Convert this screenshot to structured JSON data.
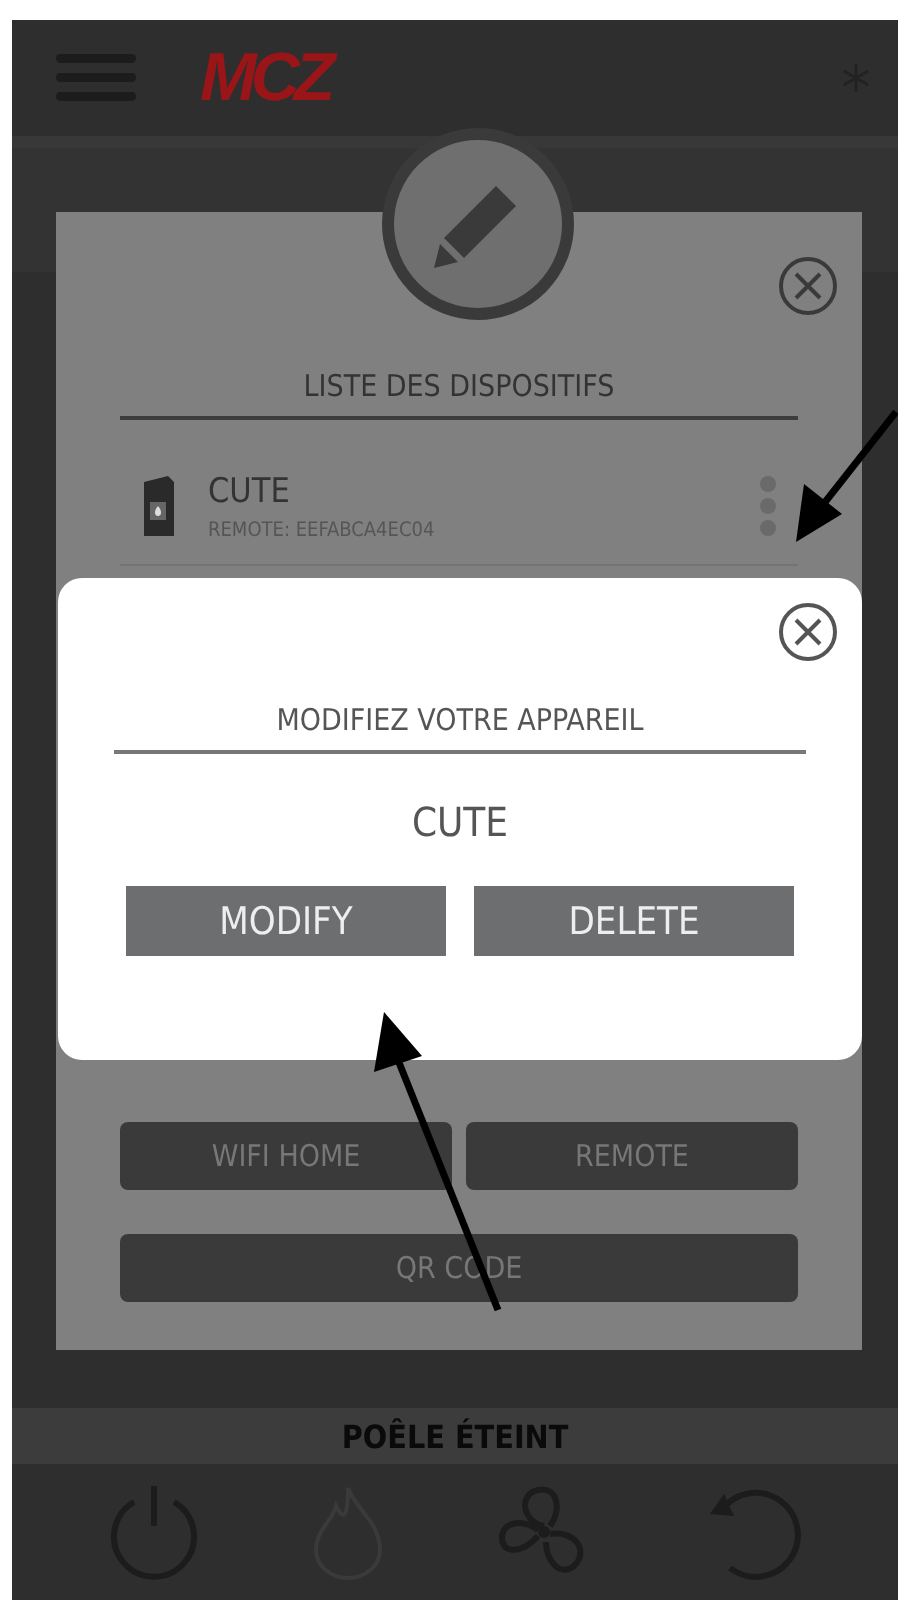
{
  "header": {
    "logo": "MCZ"
  },
  "device_panel": {
    "title": "LISTE DES DISPOSITIFS",
    "devices": [
      {
        "name": "CUTE",
        "detail": "REMOTE: EEFABCA4EC04"
      }
    ],
    "buttons": [
      "WIFI HOME",
      "REMOTE"
    ],
    "wide_button": "QR CODE"
  },
  "modal": {
    "title": "MODIFIEZ VOTRE APPAREIL",
    "device_name": "CUTE",
    "buttons": [
      "MODIFY",
      "DELETE"
    ]
  },
  "status": "POÊLE ÉTEINT",
  "bottom_nav": [
    {
      "kind": "power",
      "disabled": false
    },
    {
      "kind": "flame",
      "disabled": true
    },
    {
      "kind": "fan",
      "disabled": false
    },
    {
      "kind": "refresh",
      "disabled": false
    }
  ]
}
